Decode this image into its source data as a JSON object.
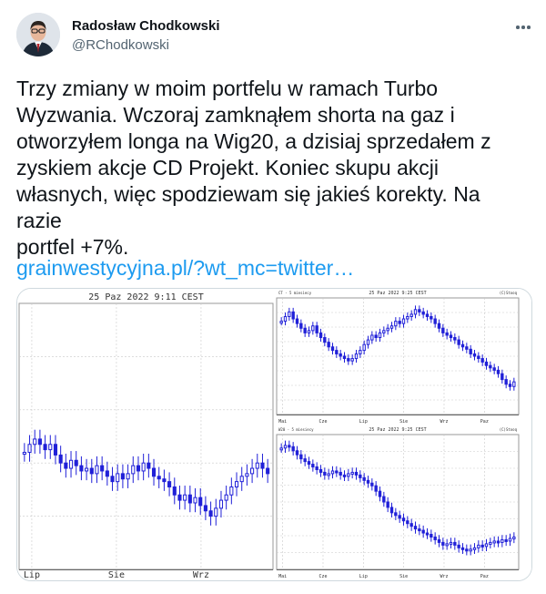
{
  "author": {
    "name": "Radosław Chodkowski",
    "handle": "@RChodkowski"
  },
  "tweet": {
    "text": "Trzy zmiany w moim portfelu w ramach Turbo\nWyzwania. Wczoraj zamknąłem shorta na gaz i\notworzyłem longa na Wig20, a dzisiaj sprzedałem z\nzyskiem akcje CD Projekt. Koniec skupu akcji\nwłasnych, więc spodziewam się jakieś korekty. Na razie\nportfel +7%.",
    "link": "grainwestycyjna.pl/?wt_mc=twitter…"
  },
  "icons": {
    "more": "more-horizontal-icon",
    "avatar": "profile-photo"
  },
  "colors": {
    "link": "#1d9bf0",
    "candle": "#2020d8",
    "grid": "#c9c9c9",
    "secondary_text": "#536471"
  },
  "chart_data": [
    {
      "type": "candlestick",
      "title": "25 Paz 2022 9:11 CEST",
      "x_ticks": [
        "Lip",
        "Sie",
        "Wrz"
      ],
      "values": [
        44,
        47,
        49,
        47,
        45,
        47,
        43,
        40,
        38,
        41,
        39,
        37,
        38,
        36,
        39,
        37,
        35,
        33,
        36,
        34,
        36,
        39,
        37,
        40,
        38,
        35,
        34,
        33,
        31,
        28,
        26,
        28,
        25,
        27,
        24,
        22,
        20,
        23,
        26,
        28,
        31,
        33,
        35,
        36,
        38,
        40,
        38,
        36
      ],
      "ylim": [
        0,
        100
      ]
    },
    {
      "type": "candlestick",
      "title": "25 Paz 2022 9:25 CEST",
      "series_label": "CT - 5 miesiecy",
      "watermark": "(C)Stooq",
      "x_ticks": [
        "Mai",
        "Cze",
        "Lip",
        "Sie",
        "Wrz",
        "Paz"
      ],
      "values": [
        80,
        84,
        88,
        82,
        78,
        74,
        70,
        72,
        76,
        70,
        66,
        62,
        58,
        55,
        52,
        50,
        48,
        46,
        48,
        52,
        55,
        60,
        64,
        68,
        66,
        70,
        72,
        74,
        76,
        80,
        78,
        82,
        84,
        86,
        90,
        88,
        86,
        84,
        82,
        78,
        74,
        70,
        68,
        66,
        64,
        60,
        58,
        56,
        52,
        50,
        48,
        45,
        42,
        40,
        38,
        35,
        30,
        26,
        24,
        28
      ],
      "ylim": [
        0,
        100
      ]
    },
    {
      "type": "candlestick",
      "title": "25 Paz 2022 9:25 CEST",
      "series_label": "W20 - 5 miesiecy",
      "watermark": "(C)Stooq",
      "x_ticks": [
        "Mai",
        "Cze",
        "Lip",
        "Sie",
        "Wrz",
        "Paz"
      ],
      "values": [
        90,
        92,
        91,
        88,
        85,
        82,
        80,
        78,
        76,
        74,
        72,
        70,
        71,
        73,
        72,
        70,
        69,
        71,
        72,
        70,
        68,
        66,
        64,
        62,
        58,
        54,
        50,
        46,
        42,
        40,
        38,
        36,
        34,
        32,
        30,
        29,
        27,
        26,
        24,
        22,
        20,
        18,
        19,
        20,
        18,
        16,
        15,
        14,
        15,
        16,
        18,
        17,
        19,
        20,
        21,
        20,
        22,
        21,
        23,
        24
      ],
      "ylim": [
        0,
        100
      ]
    }
  ]
}
